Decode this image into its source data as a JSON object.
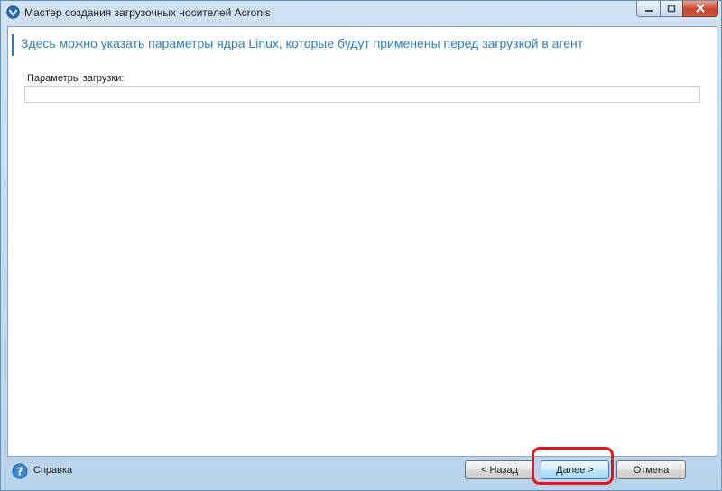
{
  "window": {
    "title": "Мастер создания загрузочных носителей Acronis",
    "controls": {
      "minimize": "minimize-icon",
      "maximize": "maximize-icon",
      "close": "close-icon"
    }
  },
  "main": {
    "header": "Здесь можно указать параметры ядра Linux, которые будут применены перед загрузкой в агент",
    "field_label": "Параметры загрузки:",
    "field_value": ""
  },
  "footer": {
    "help_label": "Справка",
    "back_label": "< Назад",
    "next_label": "Далее >",
    "cancel_label": "Отмена"
  },
  "colors": {
    "header_text": "#2f7ec2",
    "highlight": "#e8131b"
  }
}
